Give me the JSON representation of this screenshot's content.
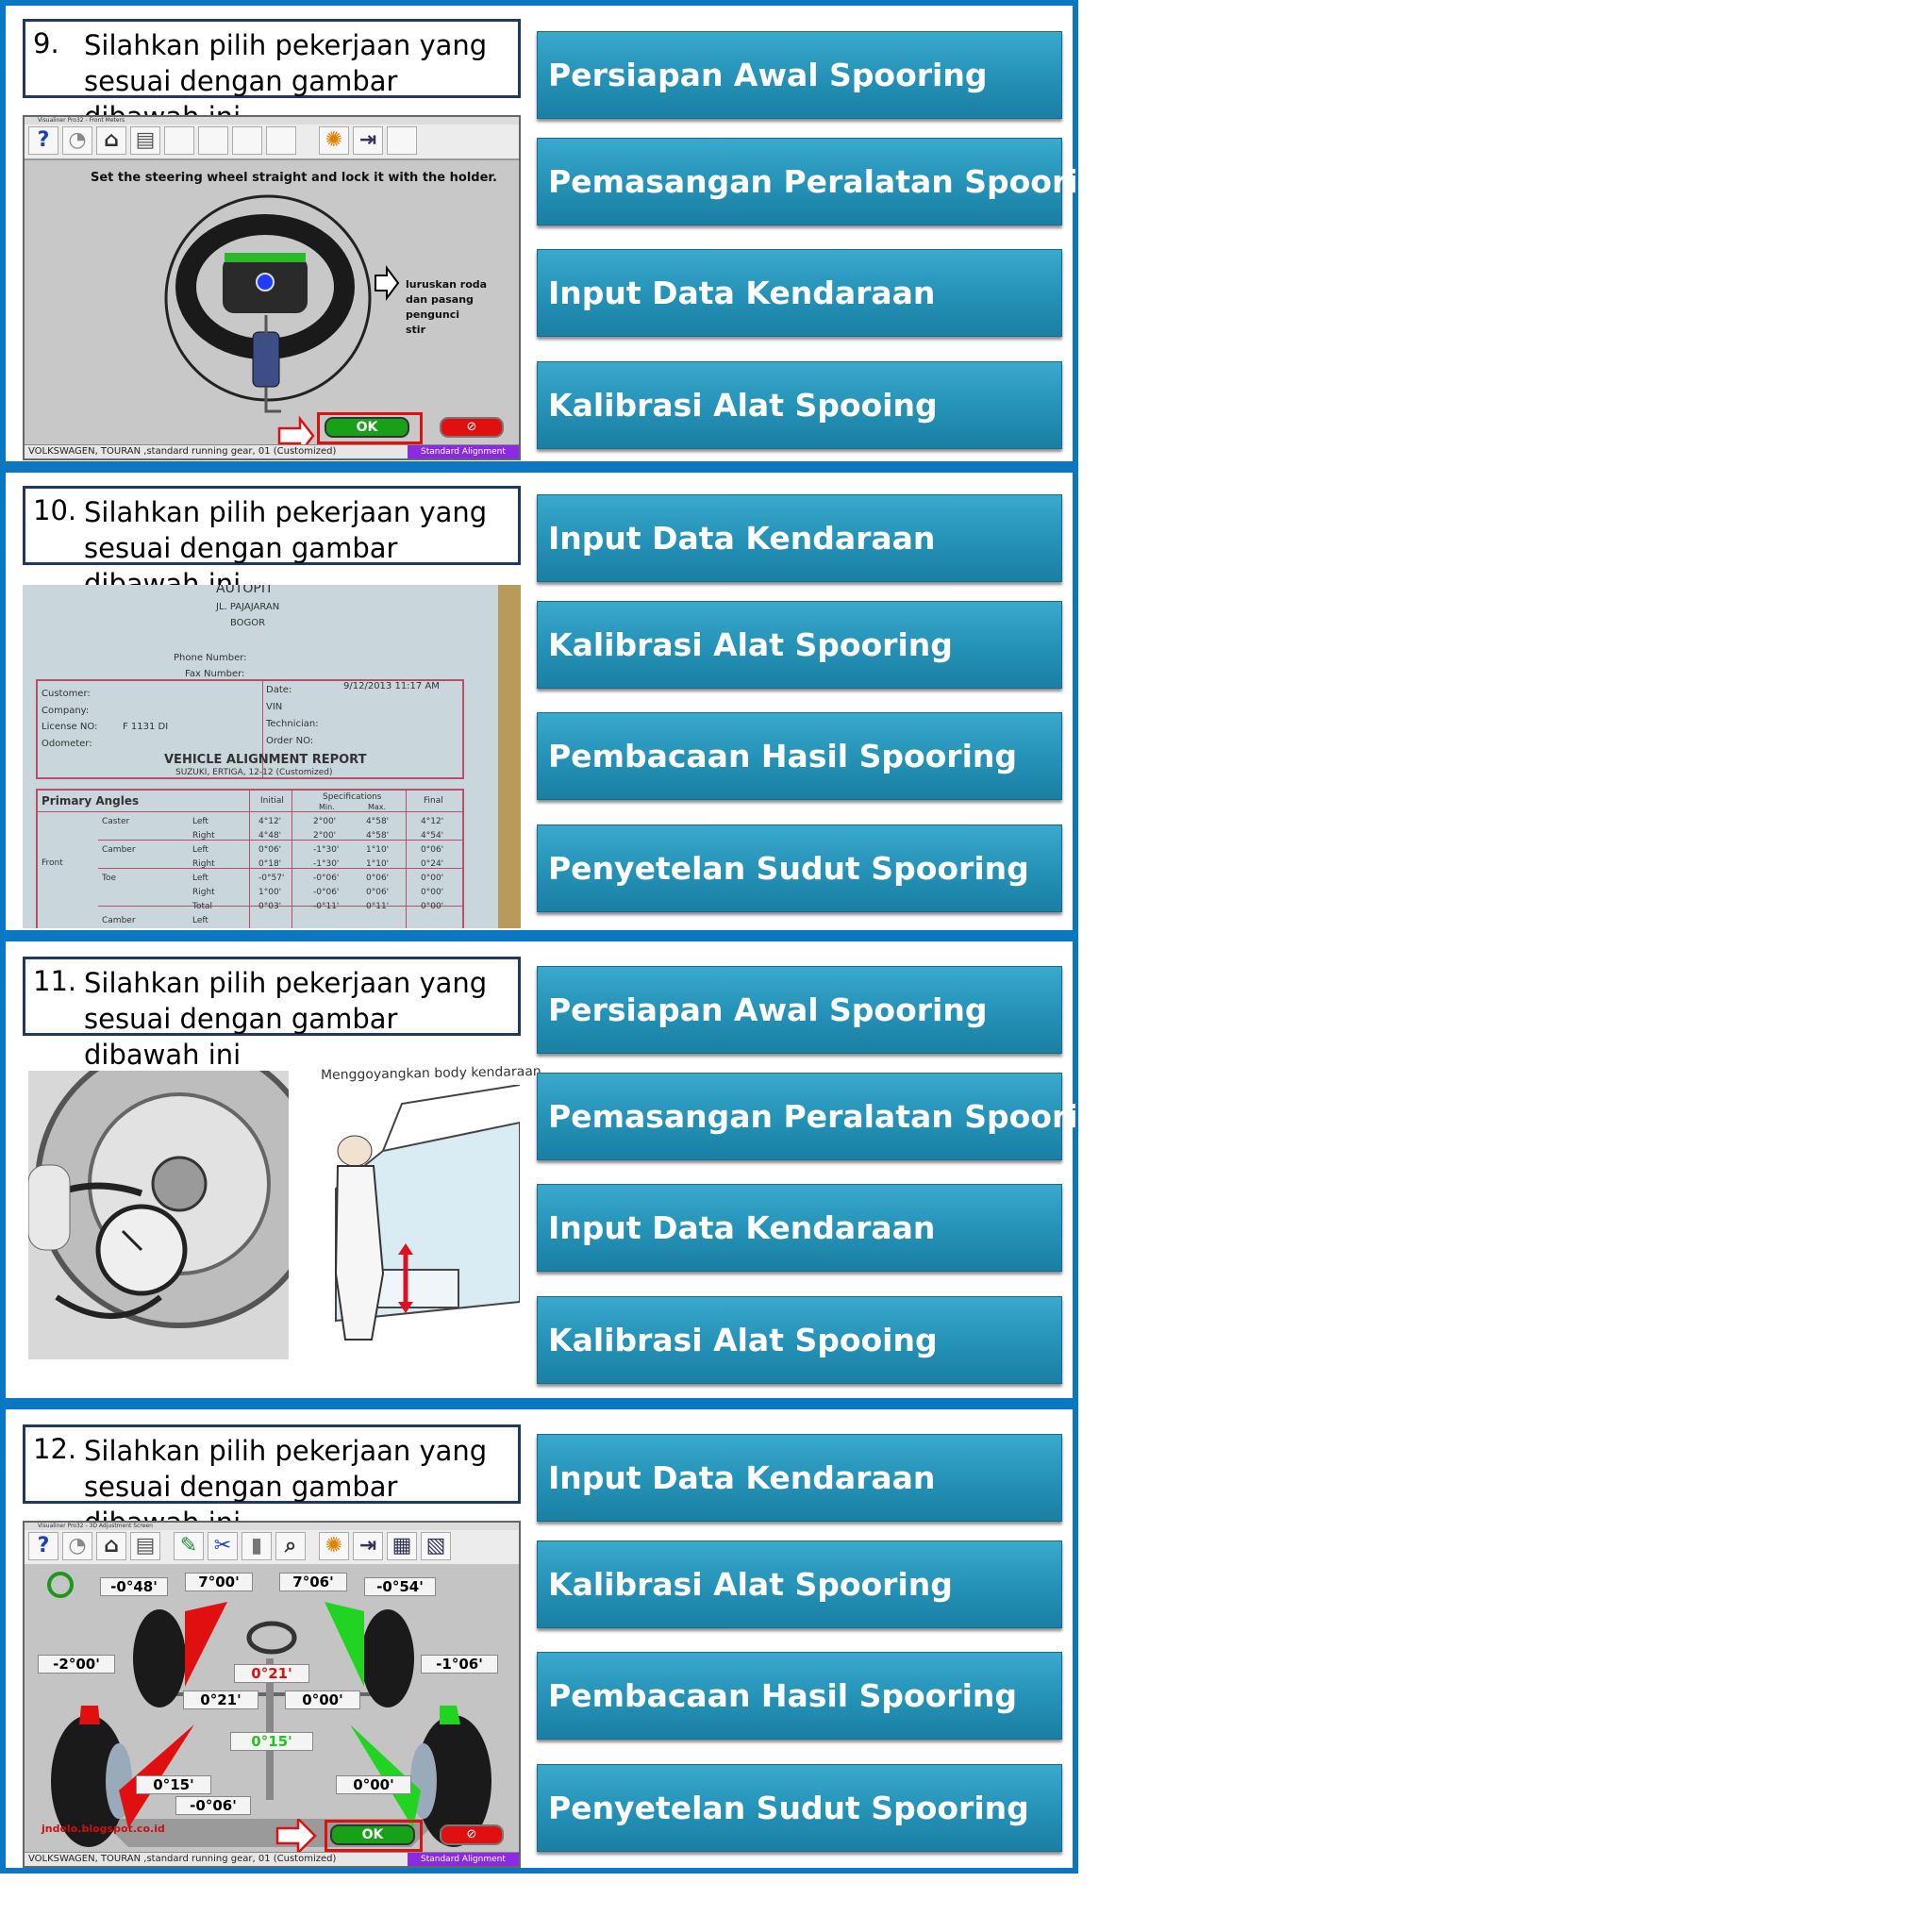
{
  "questions": [
    {
      "number": "9.",
      "line1": "Silahkan pilih pekerjaan yang",
      "line2": "sesuai dengan gambar dibawah ini",
      "options": [
        "Persiapan Awal Spooring",
        "Pemasangan Peralatan Spooring",
        "Input Data Kendaraan",
        "Kalibrasi Alat Spooing"
      ],
      "screen": {
        "window_title": "Visualiner Pro32 - Front Meters",
        "instruction": "Set the steering wheel straight and lock it with the holder.",
        "note": [
          "luruskan roda",
          "dan pasang",
          "pengunci",
          "stir"
        ],
        "ok_label": "OK",
        "status_left": "VOLKSWAGEN, TOURAN ,standard running gear, 01 (Customized)",
        "status_right": "Standard Alignment"
      }
    },
    {
      "number": "10.",
      "line1": "Silahkan pilih pekerjaan yang",
      "line2": "sesuai dengan gambar dibawah ini",
      "options": [
        "Input Data Kendaraan",
        "Kalibrasi Alat Spooring",
        "Pembacaan Hasil Spooring",
        "Penyetelan Sudut Spooring"
      ],
      "report": {
        "shop": "AUTOPIT",
        "address1": "JL. PAJAJARAN",
        "address2": "BOGOR",
        "phone": "Phone Number:",
        "fax": "Fax Number:",
        "customer": "Customer:",
        "company": "Company:",
        "license_label": "License NO:",
        "license_value": "F 1131 DI",
        "odometer": "Odometer:",
        "date_label": "Date:",
        "date_value": "9/12/2013  11:17 AM",
        "vin": "VIN",
        "technician": "Technician:",
        "order": "Order NO:",
        "report_title": "VEHICLE ALIGNMENT REPORT",
        "vehicle": "SUZUKI, ERTIGA, 12-12 (Customized)",
        "primary": "Primary Angles",
        "col_initial": "Initial",
        "col_spec": "Specifications",
        "col_min": "Min.",
        "col_max": "Max.",
        "col_final": "Final",
        "front": "Front",
        "rows": [
          {
            "angle": "Caster",
            "side": "Left",
            "initial": "4°12'",
            "min": "2°00'",
            "max": "4°58'",
            "final": "4°12'"
          },
          {
            "angle": "",
            "side": "Right",
            "initial": "4°48'",
            "min": "2°00'",
            "max": "4°58'",
            "final": "4°54'"
          },
          {
            "angle": "Camber",
            "side": "Left",
            "initial": "0°06'",
            "min": "-1°30'",
            "max": "1°10'",
            "final": "0°06'"
          },
          {
            "angle": "",
            "side": "Right",
            "initial": "0°18'",
            "min": "-1°30'",
            "max": "1°10'",
            "final": "0°24'"
          },
          {
            "angle": "Toe",
            "side": "Left",
            "initial": "-0°57'",
            "min": "-0°06'",
            "max": "0°06'",
            "final": "0°00'"
          },
          {
            "angle": "",
            "side": "Right",
            "initial": "1°00'",
            "min": "-0°06'",
            "max": "0°06'",
            "final": "0°00'"
          },
          {
            "angle": "",
            "side": "Total",
            "initial": "0°03'",
            "min": "-0°11'",
            "max": "0°11'",
            "final": "0°00'"
          },
          {
            "angle": "Camber",
            "side": "Left",
            "initial": "",
            "min": "",
            "max": "",
            "final": ""
          }
        ]
      }
    },
    {
      "number": "11.",
      "line1": "Silahkan pilih pekerjaan yang",
      "line2": "sesuai dengan gambar dibawah ini",
      "options": [
        "Persiapan Awal Spooring",
        "Pemasangan Peralatan Spooring",
        "Input Data Kendaraan",
        "Kalibrasi Alat Spooing"
      ],
      "caption": "Menggoyangkan body kendaraan"
    },
    {
      "number": "12.",
      "line1": "Silahkan pilih pekerjaan yang",
      "line2": "sesuai dengan gambar dibawah ini",
      "options": [
        "Input Data Kendaraan",
        "Kalibrasi Alat Spooring",
        "Pembacaan Hasil Spooring",
        "Penyetelan Sudut Spooring"
      ],
      "screen": {
        "window_title": "Visualiner Pro32 - 3D Adjustment Screen",
        "fl_camber": "-0°48'",
        "fl_toe": "7°00'",
        "fr_toe": "7°06'",
        "fr_camber": "-0°54'",
        "rl_camber": "-2°00'",
        "rr_camber": "-1°06'",
        "steer": "0°21'",
        "front_left_toe": "0°21'",
        "front_right_toe": "0°00'",
        "thrust": "0°15'",
        "rear_left_toe": "0°15'",
        "rear_right_toe": "0°00'",
        "rear_total": "-0°06'",
        "watermark": "jndelo.blogspot.co.id",
        "ok_label": "OK",
        "status_left": "VOLKSWAGEN, TOURAN ,standard running gear, 01 (Customized)",
        "status_right": "Standard Alignment"
      }
    }
  ]
}
